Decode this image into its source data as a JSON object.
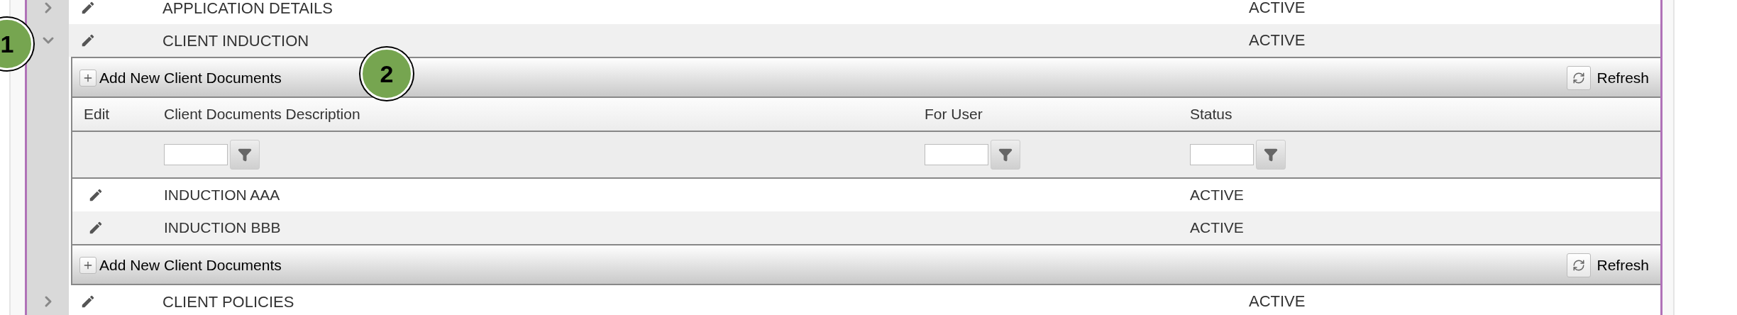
{
  "rows": [
    {
      "title": "APPLICATION DETAILS",
      "status": "ACTIVE",
      "expanded": false
    },
    {
      "title": "CLIENT INDUCTION",
      "status": "ACTIVE",
      "expanded": true,
      "detail": {
        "top_toolbar": {
          "add": "Add New Client Documents",
          "refresh": "Refresh"
        },
        "columns": [
          "Edit",
          "Client Documents Description",
          "For User",
          "Status"
        ],
        "filters": [
          false,
          true,
          true,
          true
        ],
        "rows": [
          {
            "description": "INDUCTION AAA",
            "status": "ACTIVE"
          },
          {
            "description": "INDUCTION BBB",
            "status": "ACTIVE"
          }
        ],
        "bottom_toolbar": {
          "add": "Add New Client Documents",
          "refresh": "Refresh"
        }
      }
    },
    {
      "title": "CLIENT POLICIES",
      "status": "ACTIVE",
      "expanded": false
    }
  ],
  "callouts": [
    "1",
    "2"
  ]
}
